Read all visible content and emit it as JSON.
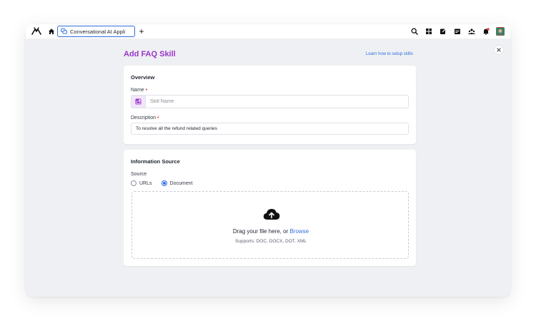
{
  "topbar": {
    "tab_label": "Conversational AI Appli",
    "add_tab": "+"
  },
  "page": {
    "title": "Add FAQ Skill",
    "learn_link": "Learn how to setup skills"
  },
  "overview": {
    "title": "Overview",
    "name_label": "Name",
    "name_placeholder": "Skill Name",
    "description_label": "Description",
    "description_value": "To resolve all the refund related queries",
    "required_mark": "•"
  },
  "info_source": {
    "title": "Information Source",
    "source_label": "Source",
    "options": [
      {
        "label": "URLs",
        "checked": false
      },
      {
        "label": "Document",
        "checked": true
      }
    ],
    "drag_text": "Drag your file here, or ",
    "browse": "Browse",
    "supports": "Supports: DOC, DOCX, DOT, XML"
  },
  "colors": {
    "accent_purple": "#9b35c9",
    "link_blue": "#2f6fdf",
    "required_red": "#d63031"
  }
}
